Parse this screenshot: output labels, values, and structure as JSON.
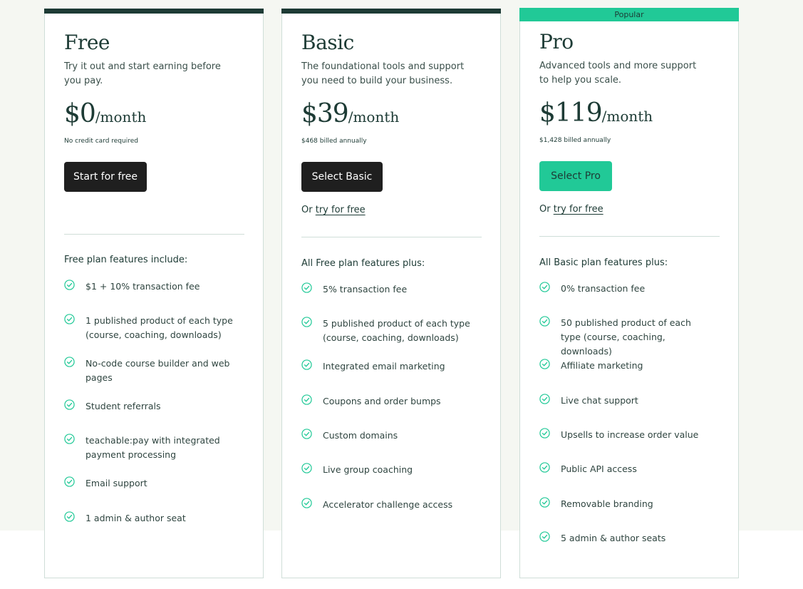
{
  "colors": {
    "dark": "#1d3b35",
    "accent": "#21c997",
    "button_dark": "#1f1f1f",
    "divider": "#cfded8"
  },
  "plans": {
    "free": {
      "name": "Free",
      "description": "Try it out and start earning before you pay.",
      "price": "$0",
      "period": "/month",
      "price_note": "No credit card required",
      "button_label": "Start for free",
      "features_heading": "Free plan features include:",
      "features": [
        "$1 + 10% transaction fee",
        "1 published product of each type (course, coaching, downloads)",
        "No-code course builder and web pages",
        "Student referrals",
        "teachable:pay with integrated payment processing",
        "Email support",
        "1 admin & author seat"
      ]
    },
    "basic": {
      "name": "Basic",
      "description": "The foundational tools and support you need to build your business.",
      "price": "$39",
      "period": "/month",
      "price_note": "$468 billed annually",
      "button_label": "Select Basic",
      "try_prefix": "Or",
      "try_link": "try for free",
      "features_heading": "All Free plan features plus:",
      "features": [
        "5% transaction fee",
        "5 published product of each type (course, coaching, downloads)",
        "Integrated email marketing",
        "Coupons and order bumps",
        "Custom domains",
        "Live group coaching",
        "Accelerator challenge access"
      ]
    },
    "pro": {
      "badge": "Popular",
      "name": "Pro",
      "description": "Advanced tools and more support to help you scale.",
      "price": "$119",
      "period": "/month",
      "price_note": "$1,428 billed annually",
      "button_label": "Select Pro",
      "try_prefix": "Or",
      "try_link": "try for free",
      "features_heading": "All Basic plan features plus:",
      "features": [
        "0% transaction fee",
        "50 published product of each type (course, coaching, downloads)",
        "Affiliate marketing",
        "Live chat support",
        "Upsells to increase order value",
        "Public API access",
        "Removable branding",
        "5 admin & author seats"
      ]
    }
  }
}
